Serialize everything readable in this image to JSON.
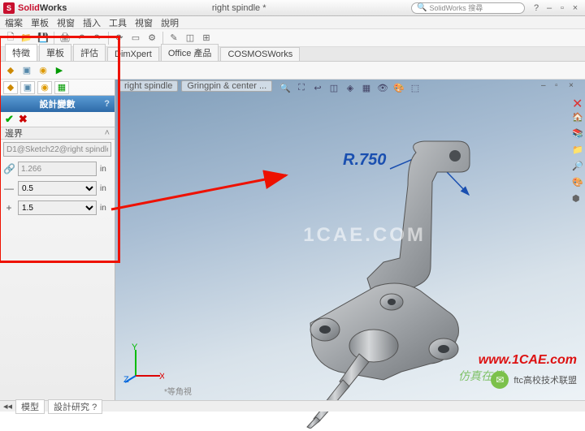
{
  "app": {
    "brand1": "Solid",
    "brand2": "Works",
    "doc": "right spindle *",
    "search_placeholder": "SolidWorks 搜尋"
  },
  "menu": [
    "檔案",
    "單板",
    "視窗",
    "插入",
    "工具",
    "視窗",
    "說明"
  ],
  "ribbon": [
    "特徵",
    "單板",
    "評估",
    "DimXpert",
    "Office 產品",
    "COSMOSWorks"
  ],
  "vpTabs": {
    "t1": "right spindle",
    "t2": "Gringpin & center ..."
  },
  "panel": {
    "title": "設計變數",
    "help": "?",
    "section": "邊界",
    "ref": "D1@Sketch22@right spindle",
    "nominal": "1.266",
    "lower": "0.5",
    "upper": "1.5",
    "unit": "in"
  },
  "dimension": "R.750",
  "watermarks": {
    "center": "1CAE.COM",
    "url": "www.1CAE.com",
    "badge": "仿真在线",
    "chat": "ftc高校技术联盟"
  },
  "iso": "*等角視",
  "bottomTabs": [
    "模型",
    "設計研究 ?"
  ]
}
